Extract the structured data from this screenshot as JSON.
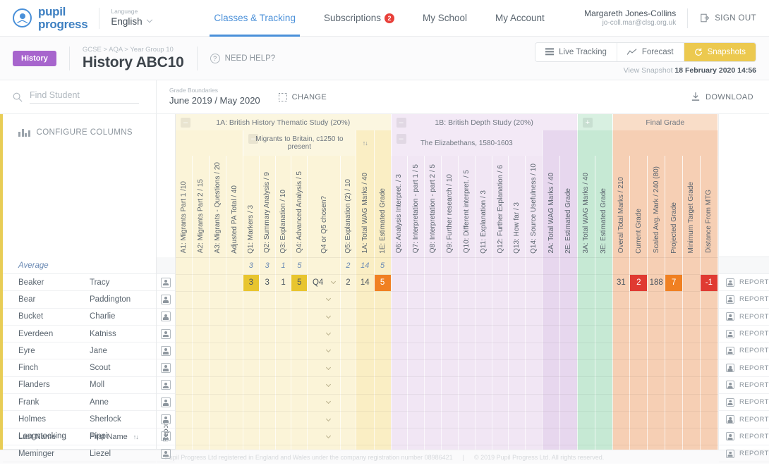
{
  "topnav": {
    "brand_line1": "pupil",
    "brand_line2": "progress",
    "language_label": "Language",
    "language_value": "English",
    "links": [
      {
        "label": "Classes & Tracking",
        "active": true,
        "badge": ""
      },
      {
        "label": "Subscriptions",
        "active": false,
        "badge": "2"
      },
      {
        "label": "My School",
        "active": false,
        "badge": ""
      },
      {
        "label": "My Account",
        "active": false,
        "badge": ""
      }
    ],
    "user_name": "Margareth Jones-Collins",
    "user_email": "jo-coll.mar@clsg.org.uk",
    "sign_out": "SIGN OUT"
  },
  "subheader": {
    "subject_pill": "History",
    "breadcrumb": "GCSE > AQA > Year Group 10",
    "title": "History ABC10",
    "need_help": "NEED HELP?",
    "modes": [
      {
        "label": "Live Tracking",
        "active": false
      },
      {
        "label": "Forecast",
        "active": false
      },
      {
        "label": "Snapshots",
        "active": true
      }
    ],
    "snapshot_prefix": "View Snapshot",
    "snapshot_date": "18 February 2020 14:56"
  },
  "toolbar": {
    "search_placeholder": "Find Student",
    "search_value": "",
    "grade_boundaries_label": "Grade Boundaries",
    "grade_boundaries_value": "June 2019 / May 2020",
    "change_label": "CHANGE",
    "download_label": "DOWNLOAD"
  },
  "left": {
    "configure_columns": "CONFIGURE COLUMNS",
    "col_last_name": "Last Name",
    "col_first_name": "First Name",
    "col_report": "Report"
  },
  "sections": [
    {
      "id": "1A",
      "title": "1A: British History Thematic Study (20%)",
      "collapse": "–",
      "tone": "yl"
    },
    {
      "id": "1B",
      "title": "1B: British Depth Study (20%)",
      "collapse": "–",
      "tone": "pu"
    },
    {
      "id": "3",
      "title": "",
      "collapse": "+",
      "tone": "gr"
    },
    {
      "id": "FG",
      "title": "Final Grade",
      "collapse": "",
      "tone": "or"
    }
  ],
  "subsections": [
    {
      "title": "Migrants to Britain, c1250 to present",
      "collapse": "–"
    },
    {
      "title": "The Elizabethans, 1580-1603",
      "collapse": "–"
    }
  ],
  "columns": [
    {
      "label": "A1: Migrants Part 1  /10",
      "tone": "yl"
    },
    {
      "label": "A2: Migrants Part 2 / 15",
      "tone": "yl"
    },
    {
      "label": "A3: Migrants - Questions / 20",
      "tone": "yl"
    },
    {
      "label": "Adjusted PA Total / 40",
      "tone": "yl"
    },
    {
      "label": "Q1: Markers / 3",
      "tone": "yl"
    },
    {
      "label": "Q2: Summary Analysis / 9",
      "tone": "yl"
    },
    {
      "label": "Q3: Explanation / 10",
      "tone": "yl"
    },
    {
      "label": "Q4: Advanced Analysis / 5",
      "tone": "yl"
    },
    {
      "label": "Q4 or Q5 chosen?",
      "tone": "yl"
    },
    {
      "label": "Q5: Explanation (2) / 10",
      "tone": "yl"
    },
    {
      "label": "1A: Total WAG Marks / 40",
      "tone": "yl2"
    },
    {
      "label": "1E: Estimated Grade",
      "tone": "yl2"
    },
    {
      "label": "Q6: Analysis Interpret. / 3",
      "tone": "pu"
    },
    {
      "label": "Q7: Interpretation - part 1 / 5",
      "tone": "pu"
    },
    {
      "label": "Q8: Interpretation - part 2 / 5",
      "tone": "pu"
    },
    {
      "label": "Q9: Further research / 10",
      "tone": "pu"
    },
    {
      "label": "Q10: Different interpret. / 5",
      "tone": "pu"
    },
    {
      "label": "Q11: Explanation / 3",
      "tone": "pu"
    },
    {
      "label": "Q12: Further Explanation / 6",
      "tone": "pu"
    },
    {
      "label": "Q13: How far / 3",
      "tone": "pu"
    },
    {
      "label": "Q14: Source Usefulness / 10",
      "tone": "pu"
    },
    {
      "label": "2A: Total WAG Marks / 40",
      "tone": "pu2"
    },
    {
      "label": "2E: Estimated Grade",
      "tone": "pu2"
    },
    {
      "label": "3A: Total WAG Marks / 40",
      "tone": "gr"
    },
    {
      "label": "3E: Estimated Grade",
      "tone": "gr"
    },
    {
      "label": "Overal Total Marks / 210",
      "tone": "or"
    },
    {
      "label": "Current Grade",
      "tone": "or"
    },
    {
      "label": "Scaled Avg. Mark / 240 (80)",
      "tone": "or"
    },
    {
      "label": "Projected Grade",
      "tone": "or"
    },
    {
      "label": "Minimum Target Grade",
      "tone": "or"
    },
    {
      "label": "Distance From MTG",
      "tone": "or"
    }
  ],
  "average_row": {
    "label": "Average",
    "values": [
      "",
      "",
      "",
      "",
      "3",
      "3",
      "1",
      "5",
      "",
      "2",
      "14",
      "5",
      "",
      "",
      "",
      "",
      "",
      "",
      "",
      "",
      "",
      "",
      "",
      "",
      "",
      "",
      "",
      "",
      "",
      "",
      ""
    ]
  },
  "students": [
    {
      "last": "Beaker",
      "first": "Tracy",
      "values": [
        "",
        "",
        "",
        "",
        "3",
        "3",
        "1",
        "5",
        "Q4",
        "2",
        "14",
        "5",
        "",
        "",
        "",
        "",
        "",
        "",
        "",
        "",
        "",
        "",
        "",
        "",
        "",
        "31",
        "2",
        "188",
        "7",
        "",
        "-1"
      ],
      "marks": {
        "4": "y",
        "7": "y",
        "11": "o",
        "26": "r",
        "28": "o",
        "30": "r"
      }
    },
    {
      "last": "Bear",
      "first": "Paddington",
      "values": [],
      "marks": {}
    },
    {
      "last": "Bucket",
      "first": "Charlie",
      "values": [],
      "marks": {}
    },
    {
      "last": "Everdeen",
      "first": "Katniss",
      "values": [],
      "marks": {}
    },
    {
      "last": "Eyre",
      "first": "Jane",
      "values": [],
      "marks": {}
    },
    {
      "last": "Finch",
      "first": "Scout",
      "values": [],
      "marks": {}
    },
    {
      "last": "Flanders",
      "first": "Moll",
      "values": [],
      "marks": {}
    },
    {
      "last": "Frank",
      "first": "Anne",
      "values": [],
      "marks": {}
    },
    {
      "last": "Holmes",
      "first": "Sherlock",
      "values": [],
      "marks": {}
    },
    {
      "last": "Longstocking",
      "first": "Pippi",
      "values": [],
      "marks": {}
    },
    {
      "last": "Meminger",
      "first": "Liezel",
      "values": [],
      "marks": {}
    }
  ],
  "report_label": "REPORT",
  "footer": {
    "left": "Pupil Progress Ltd registered in England and Wales under the company registration number 08986421",
    "sep": "|",
    "right": "© 2019 Pupil Progress Ltd. All rights reserved."
  }
}
